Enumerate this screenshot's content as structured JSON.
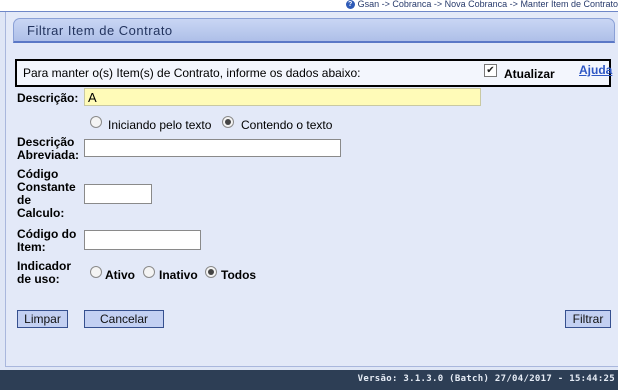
{
  "breadcrumb": {
    "text": "Gsan -> Cobranca -> Nova Cobranca -> Manter Item de Contrato"
  },
  "panel": {
    "title": "Filtrar Item de Contrato"
  },
  "info": {
    "message": "Para manter o(s) Item(s) de Contrato, informe os dados abaixo:",
    "atualizar_label": "Atualizar",
    "atualizar_checked": true,
    "help_link": "Ajuda"
  },
  "form": {
    "descricao": {
      "label": "Descrição:",
      "value": "A"
    },
    "search_mode": {
      "options": [
        "Iniciando pelo texto",
        "Contendo o texto"
      ],
      "selected": "Contendo o texto"
    },
    "descricao_abreviada": {
      "label_line1": "Descrição",
      "label_line2": "Abreviada:",
      "value": ""
    },
    "codigo_constante": {
      "label_line1": "Código",
      "label_line2": "Constante",
      "label_line3": "de",
      "label_line4": "Calculo:",
      "value": ""
    },
    "codigo_item": {
      "label_line1": "Código do",
      "label_line2": "Item:",
      "value": ""
    },
    "indicador_uso": {
      "label_line1": "Indicador",
      "label_line2": "de uso:",
      "options": [
        "Ativo",
        "Inativo",
        "Todos"
      ],
      "selected": "Todos"
    }
  },
  "buttons": {
    "limpar": "Limpar",
    "cancelar": "Cancelar",
    "filtrar": "Filtrar"
  },
  "footer": {
    "version": "Versão: 3.1.3.0 (Batch) 27/04/2017 - 15:44:25"
  }
}
